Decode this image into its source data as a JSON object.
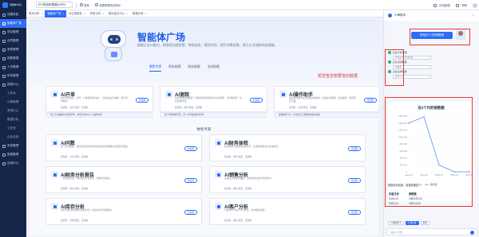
{
  "sidebar": {
    "logo_text": "智能体平台",
    "items": [
      {
        "label": "快捷导航",
        "active": false
      },
      {
        "label": "智能体广场",
        "active": true
      },
      {
        "label": "项目管理",
        "active": false
      },
      {
        "label": "合同管理",
        "active": false
      },
      {
        "label": "采购管理",
        "active": false
      },
      {
        "label": "销售管理",
        "active": false
      },
      {
        "label": "人员管理",
        "active": false
      },
      {
        "label": "财务管理",
        "active": false
      },
      {
        "label": "报表中心",
        "active": false
      },
      {
        "label": "系统管理",
        "active": false
      },
      {
        "label": "数据管理",
        "active": false
      },
      {
        "label": "应用中心",
        "active": false
      }
    ],
    "sub_items": [
      "工作台",
      "小眸助理",
      "审批中心",
      "数据分析",
      "工作流",
      "企业应用"
    ]
  },
  "topbar": {
    "company_select": "DYJ财会助理演示VPN",
    "search_btn": "搜索",
    "login_prompt": "我要看看完成演示",
    "right_items": [
      "在线客服",
      "帮助"
    ]
  },
  "tabs": [
    {
      "label": "首页分析",
      "active": false
    },
    {
      "label": "智能体广场",
      "active": true
    },
    {
      "label": "AI生成报告",
      "active": false
    },
    {
      "label": "财务分析",
      "active": false
    },
    {
      "label": "指标监控中心",
      "active": false
    },
    {
      "label": "数据分析",
      "active": false
    }
  ],
  "banner": {
    "title": "智能体广场",
    "subtitle": "赋能企业AI能力，帮助您加速经营，降低成本，管控风险，提升决策质量，建立企业创新的加速器。"
  },
  "subtabs": [
    {
      "label": "数智专家",
      "active": true
    },
    {
      "label": "财务助理",
      "active": false
    },
    {
      "label": "财务助理",
      "active": false
    },
    {
      "label": "业务助理",
      "active": false
    }
  ],
  "top_cards": [
    {
      "title": "AI开单",
      "desc": "自动识别发票、合同、订单等单据内容，一键生成业务单据，提升录单效率。",
      "meta": "使用者：业务  类型：应用类",
      "btn": "去使用",
      "tip": "基于企业数据中台智能开单，助您节约90%人工操作时间"
    },
    {
      "title": "AI测观",
      "desc": "实时监测经营数据，智能识别异常指标并主动预警，让管理者第一时间掌握风险。",
      "meta": "使用者：财务  类型：应用类",
      "btn": "去使用",
      "tip": "基于风险规则引擎，第一时间发现经营异常"
    },
    {
      "title": "AI操作助手",
      "desc": "通过自然语言对话完成系统操作，快速查询数据、生成报表，降低使用门槛。",
      "meta": "使用者：全员  类型：应用类",
      "btn": "去使用",
      "tip": "智能操作引导，让每位员工都能轻松使用系统"
    }
  ],
  "section_title": "数智专家",
  "expert_cards": [
    {
      "title": "AI问数",
      "desc": "基于企业数据，通过自然语言提问快速获取经营数据分析结果与图表。",
      "meta": "使用者：全员  类型：应用类",
      "btn": "去使用"
    },
    {
      "title": "AI财务体检",
      "desc": "自动体检企业财务健康状况，生成体检报告与改进建议。",
      "meta": "使用者：财务  类型：应用类",
      "btn": "去使用"
    },
    {
      "title": "AI财务分析报告",
      "desc": "一键生成月度、季度财务分析报告，洞察经营趋势。",
      "meta": "使用者：财务  类型：应用类",
      "btn": "去使用"
    },
    {
      "title": "AI销售分析",
      "desc": "多维度分析销售数据，识别增长机会与风险客户。",
      "meta": "使用者：销售  类型：应用类",
      "btn": "去使用"
    },
    {
      "title": "AI库存分析",
      "desc": "智能分析库存结构与周转情况，给出补货与清理建议。",
      "meta": "使用者：仓储  类型：应用类",
      "btn": "去使用"
    },
    {
      "title": "AI客户分析",
      "desc": "分析客户价值与行为特征，助力精准营销。",
      "meta": "使用者：销售  类型：应用类",
      "btn": "去使用"
    }
  ],
  "panel": {
    "title": "小眸助手",
    "close": "×",
    "question": "查询近3个月的销售额",
    "steps": [
      {
        "label": "正在分析意图",
        "box": "查询近3个月销售额"
      },
      {
        "label": "正在识别数据",
        "box": "销售额"
      },
      {
        "label": "正在生成数据",
        "box": "近3个月"
      }
    ],
    "chart_note": "根据查询结果，数据表格如下：",
    "table_header": [
      "年度月份",
      "销售额"
    ],
    "table_rows": [
      [
        "2025-03",
        "1580290.00"
      ],
      [
        "2025-04",
        "196213.00"
      ]
    ],
    "actions": [
      "AI 编程助手",
      "AI 帮分析",
      "复制"
    ],
    "input_placeholder": "请输入问题"
  },
  "annotation": {
    "text": "帮您查您想要查的数据",
    "color": "#e53935"
  },
  "chart_data": {
    "type": "line",
    "title": "近3个月的销售额",
    "x": [
      "2025-02",
      "2025-03",
      "2025-04",
      "2025-05",
      "2025-06"
    ],
    "series": [
      {
        "name": "销售额",
        "values": [
          1400000,
          1580290,
          196213,
          0,
          0
        ]
      }
    ],
    "ylim": [
      0,
      1600000
    ],
    "yticks": [
      "0",
      "200,000",
      "400,000",
      "600,000",
      "800,000",
      "1,000,000",
      "1,200,000",
      "1,400,000",
      "1,600,000"
    ],
    "xlabel": "",
    "ylabel": "",
    "color": "#5b8ff9"
  }
}
